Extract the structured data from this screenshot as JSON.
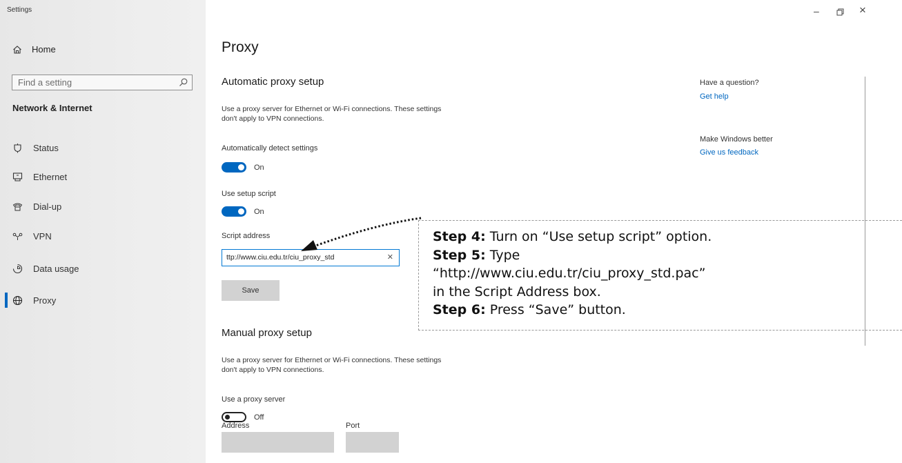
{
  "window": {
    "title": "Settings",
    "controls": {
      "minimize": "–",
      "maximize": "ð",
      "close": "×"
    }
  },
  "sidebar": {
    "home_label": "Home",
    "search_placeholder": "Find a setting",
    "section_title": "Network & Internet",
    "items": [
      {
        "label": "Status",
        "icon": "status-icon"
      },
      {
        "label": "Ethernet",
        "icon": "ethernet-icon"
      },
      {
        "label": "Dial-up",
        "icon": "dialup-icon"
      },
      {
        "label": "VPN",
        "icon": "vpn-icon"
      },
      {
        "label": "Data usage",
        "icon": "data-usage-icon"
      },
      {
        "label": "Proxy",
        "icon": "proxy-icon",
        "active": true
      }
    ]
  },
  "main": {
    "page_title": "Proxy",
    "automatic": {
      "heading": "Automatic proxy setup",
      "description_line1": "Use a proxy server for Ethernet or Wi-Fi connections. These settings",
      "description_line2": "don't apply to VPN connections.",
      "detect_label": "Automatically detect settings",
      "detect_state": "On",
      "script_label": "Use setup script",
      "script_state": "On",
      "address_label": "Script address",
      "address_value": "ttp://www.ciu.edu.tr/ciu_proxy_std",
      "save_label": "Save"
    },
    "manual": {
      "heading": "Manual proxy setup",
      "description_line1": "Use a proxy server for Ethernet or Wi-Fi connections. These settings",
      "description_line2": "don't apply to VPN connections.",
      "use_proxy_label": "Use a proxy server",
      "use_proxy_state": "Off",
      "address_label": "Address",
      "port_label": "Port"
    }
  },
  "rail": {
    "question": "Have a question?",
    "get_help": "Get help",
    "better": "Make Windows better",
    "feedback": "Give us feedback"
  },
  "annotation": {
    "step4_label": "Step 4:",
    "step4_text": " Turn on “Use setup script” option.",
    "step5_label": "Step 5:",
    "step5_text": " Type",
    "step5_url": "“http://www.ciu.edu.tr/ciu_proxy_std.pac”",
    "step5_tail": "in the Script Address box.",
    "step6_label": "Step 6:",
    "step6_text": " Press “Save” button."
  },
  "colors": {
    "accent": "#0067c0",
    "sidebar_bg": "#ececec",
    "button_bg": "#d2d2d2"
  }
}
